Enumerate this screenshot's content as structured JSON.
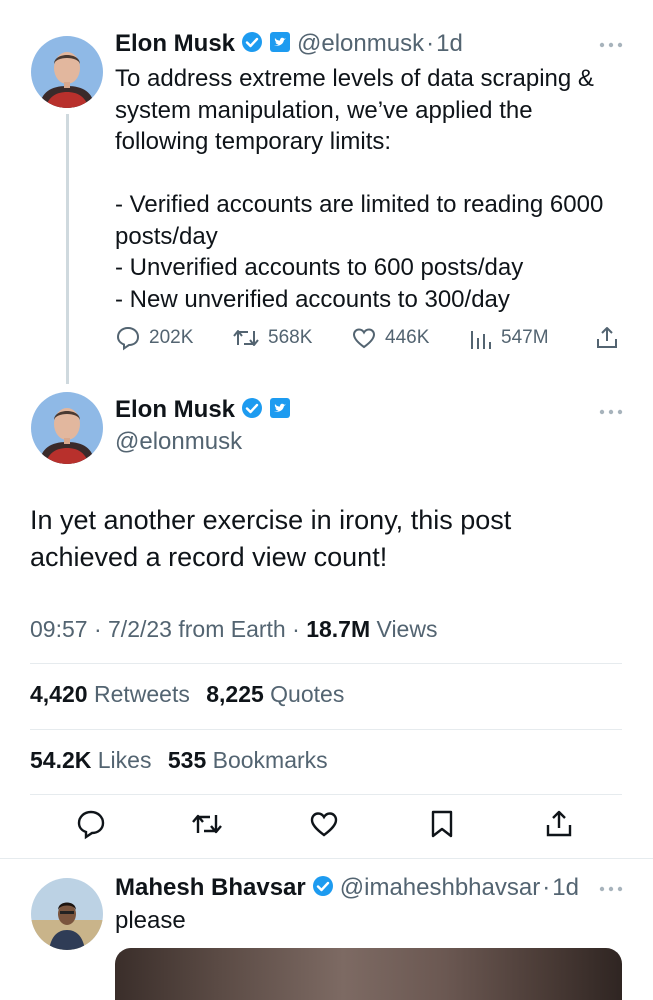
{
  "tweet_main": {
    "author_name": "Elon Musk",
    "handle": "@elonmusk",
    "dot": "·",
    "time_ago": "1d",
    "body": "To address extreme levels of data scraping & system manipulation, we’ve applied the following temporary limits:\n\n- Verified accounts are limited to reading 6000 posts/day\n- Unverified accounts to 600 posts/day\n- New unverified accounts to 300/day",
    "replies": "202K",
    "retweets": "568K",
    "likes": "446K",
    "views": "547M"
  },
  "tweet_focus": {
    "author_name": "Elon Musk",
    "handle": "@elonmusk",
    "text": "In yet another exercise in irony, this post achieved a record view count!",
    "time": "09:57",
    "date": "7/2/23",
    "source": "from Earth",
    "views_count": "18.7M",
    "views_label": "Views",
    "retweets_count": "4,420",
    "retweets_label": "Retweets",
    "quotes_count": "8,225",
    "quotes_label": "Quotes",
    "likes_count": "54.2K",
    "likes_label": "Likes",
    "bookmarks_count": "535",
    "bookmarks_label": "Bookmarks"
  },
  "reply": {
    "author_name": "Mahesh Bhavsar",
    "handle": "@imaheshbhavsar",
    "dot": "·",
    "time_ago": "1d",
    "text": "please"
  },
  "colors": {
    "text": "#0f1419",
    "secondary": "#536471",
    "verified_blue": "#1d9bf0",
    "divider": "#e6ebee"
  }
}
